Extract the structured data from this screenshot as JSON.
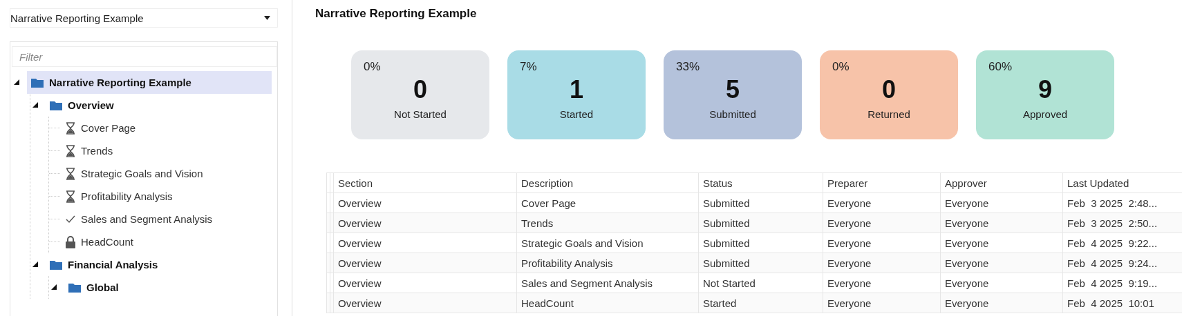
{
  "sidebar": {
    "dropdown": {
      "value": "Narrative Reporting Example"
    },
    "filter": {
      "placeholder": "Filter"
    },
    "tree": [
      {
        "label": "Narrative Reporting Example",
        "kind": "folder",
        "expanded": true,
        "selected": true,
        "children": [
          {
            "label": "Overview",
            "kind": "folder",
            "expanded": true,
            "selected": false,
            "children": [
              {
                "label": "Cover Page",
                "kind": "pending",
                "selected": false
              },
              {
                "label": "Trends",
                "kind": "pending",
                "selected": false
              },
              {
                "label": "Strategic Goals and Vision",
                "kind": "pending",
                "selected": false
              },
              {
                "label": "Profitability Analysis",
                "kind": "pending",
                "selected": false
              },
              {
                "label": "Sales and Segment Analysis",
                "kind": "done",
                "selected": false
              },
              {
                "label": "HeadCount",
                "kind": "locked",
                "selected": false
              }
            ]
          },
          {
            "label": "Financial Analysis",
            "kind": "folder",
            "expanded": true,
            "selected": false,
            "children": [
              {
                "label": "Global",
                "kind": "folder",
                "expanded": true,
                "selected": false
              }
            ]
          }
        ]
      }
    ]
  },
  "main": {
    "title": "Narrative Reporting Example",
    "cards": [
      {
        "percent": "0%",
        "count": "0",
        "label": "Not Started",
        "color": "#e6e8eb"
      },
      {
        "percent": "7%",
        "count": "1",
        "label": "Started",
        "color": "#a9dce6"
      },
      {
        "percent": "33%",
        "count": "5",
        "label": "Submitted",
        "color": "#b4c2db"
      },
      {
        "percent": "0%",
        "count": "0",
        "label": "Returned",
        "color": "#f7c3a9"
      },
      {
        "percent": "60%",
        "count": "9",
        "label": "Approved",
        "color": "#b1e3d5"
      }
    ],
    "table": {
      "columns": [
        "Section",
        "Description",
        "Status",
        "Preparer",
        "Approver",
        "Last Updated"
      ],
      "rows": [
        [
          "Overview",
          "Cover Page",
          "Submitted",
          "Everyone",
          "Everyone",
          "Feb  3 2025  2:48..."
        ],
        [
          "Overview",
          "Trends",
          "Submitted",
          "Everyone",
          "Everyone",
          "Feb  3 2025  2:50..."
        ],
        [
          "Overview",
          "Strategic Goals and Vision",
          "Submitted",
          "Everyone",
          "Everyone",
          "Feb  4 2025  9:22..."
        ],
        [
          "Overview",
          "Profitability Analysis",
          "Submitted",
          "Everyone",
          "Everyone",
          "Feb  4 2025  9:24..."
        ],
        [
          "Overview",
          "Sales and Segment Analysis",
          "Not Started",
          "Everyone",
          "Everyone",
          "Feb  4 2025  9:19..."
        ],
        [
          "Overview",
          "HeadCount",
          "Started",
          "Everyone",
          "Everyone",
          "Feb  4 2025  10:01"
        ]
      ]
    }
  }
}
